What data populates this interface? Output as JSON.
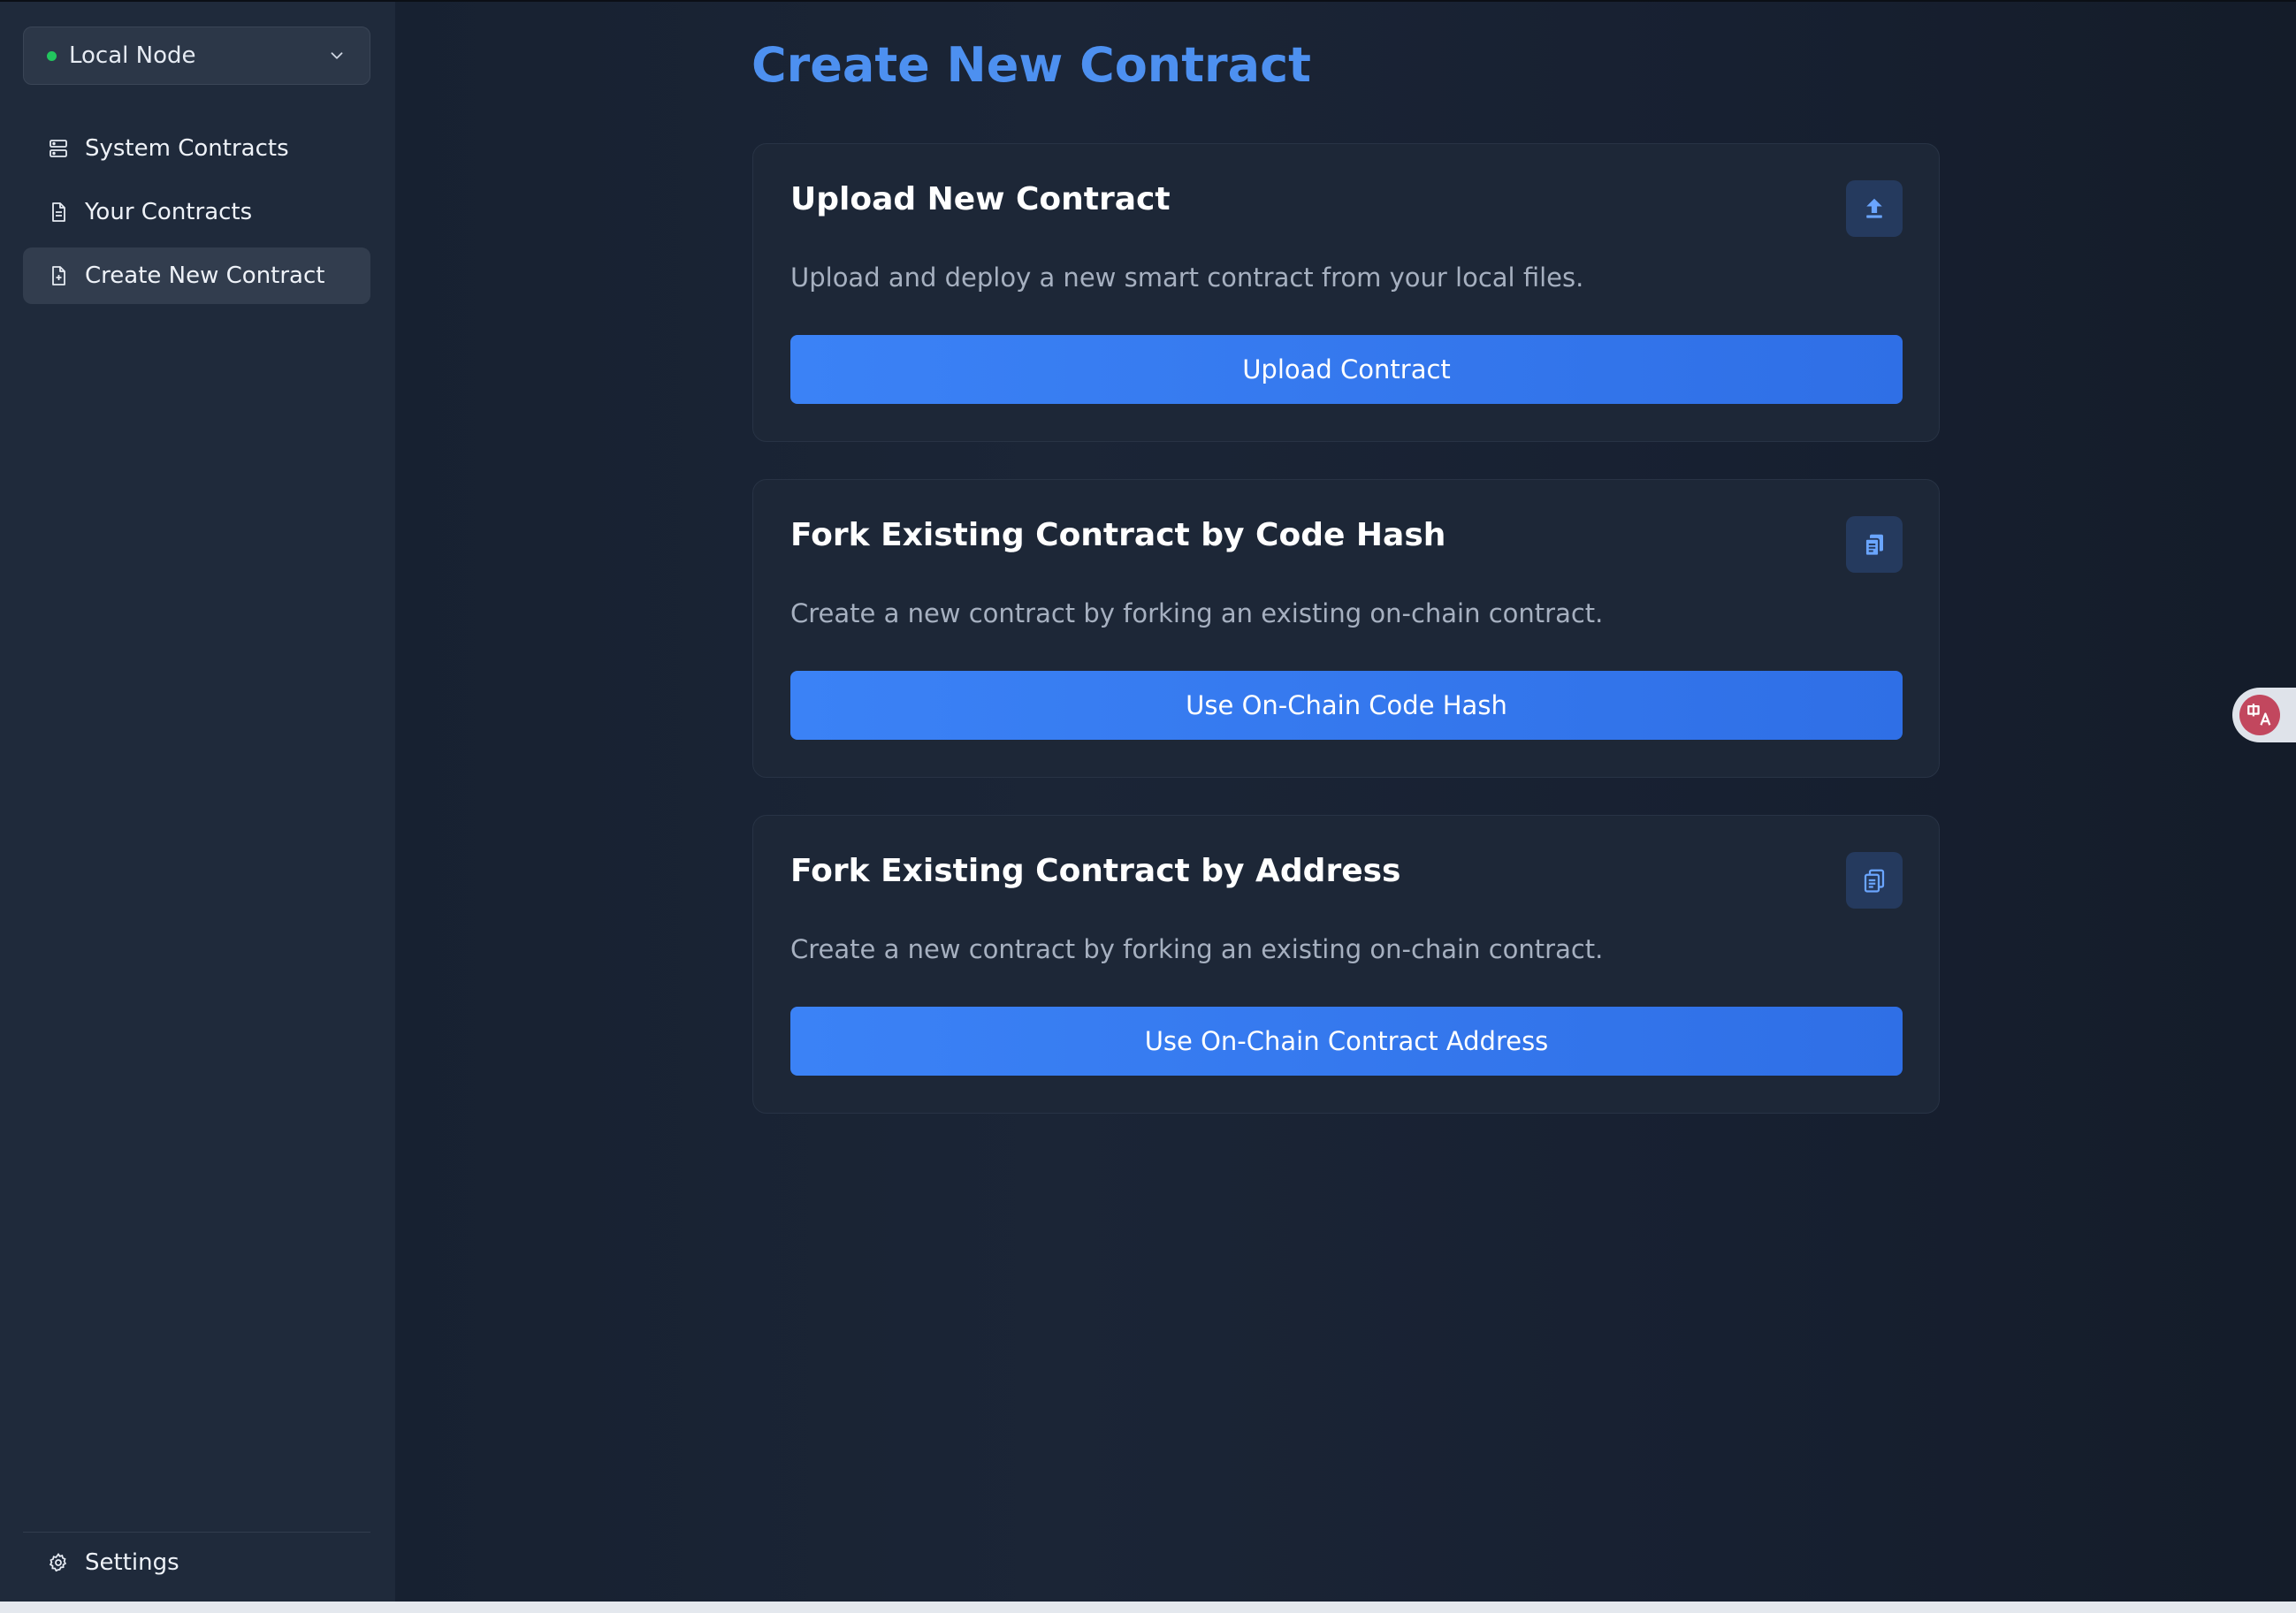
{
  "node_selector": {
    "label": "Local Node",
    "status_color": "#22c55e"
  },
  "sidebar": {
    "items": [
      {
        "label": "System Contracts",
        "icon": "server-icon"
      },
      {
        "label": "Your Contracts",
        "icon": "document-icon"
      },
      {
        "label": "Create New Contract",
        "icon": "document-plus-icon",
        "active": true
      }
    ],
    "settings_label": "Settings"
  },
  "main": {
    "title": "Create New Contract",
    "cards": [
      {
        "title": "Upload New Contract",
        "description": "Upload and deploy a new smart contract from your local files.",
        "button": "Upload Contract",
        "icon": "upload-icon"
      },
      {
        "title": "Fork Existing Contract by Code Hash",
        "description": "Create a new contract by forking an existing on-chain contract.",
        "button": "Use On-Chain Code Hash",
        "icon": "copy-filled-icon"
      },
      {
        "title": "Fork Existing Contract by Address",
        "description": "Create a new contract by forking an existing on-chain contract.",
        "button": "Use On-Chain Contract Address",
        "icon": "copy-outline-icon"
      }
    ]
  },
  "colors": {
    "accent": "#3b82f6",
    "title": "#4d90f0",
    "sidebar_bg": "#1f2a3b",
    "main_bg": "#172131"
  }
}
